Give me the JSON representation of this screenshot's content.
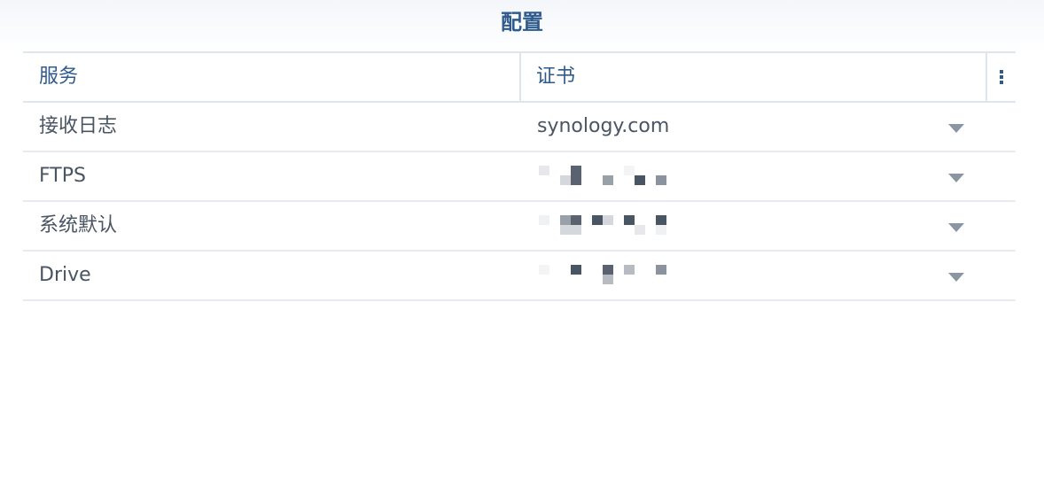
{
  "title": "配置",
  "columns": {
    "service": "服务",
    "certificate": "证书",
    "menu_icon": "vertical-dots-icon"
  },
  "rows": [
    {
      "service": "接收日志",
      "certificate": "synology.com",
      "certificate_obscured": false
    },
    {
      "service": "FTPS",
      "certificate": "",
      "certificate_obscured": true
    },
    {
      "service": "系统默认",
      "certificate": "",
      "certificate_obscured": true
    },
    {
      "service": "Drive",
      "certificate": "",
      "certificate_obscured": true
    }
  ],
  "colors": {
    "accent": "#2e5a8c",
    "text": "#4a5563",
    "border": "#dfe5ec",
    "arrow": "#8a96a3"
  }
}
